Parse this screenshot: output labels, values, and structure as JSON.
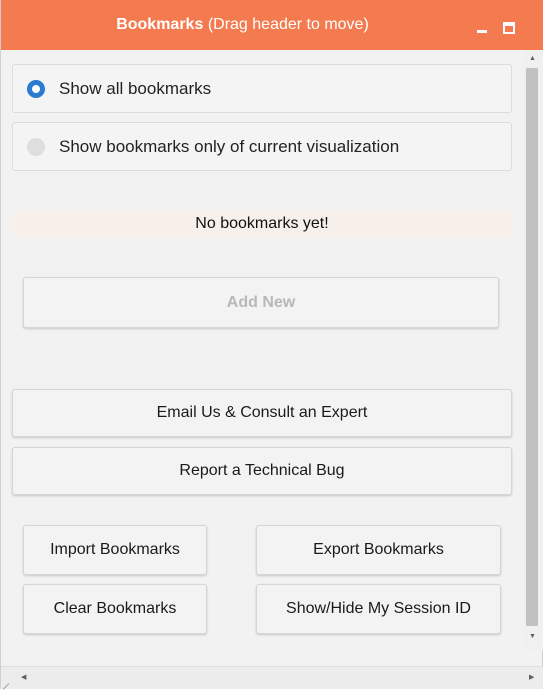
{
  "header": {
    "title": "Bookmarks",
    "subtitle": "(Drag header to move)",
    "accent_color": "#f47b4f",
    "minimize_icon": "minimize-icon",
    "maximize_icon": "maximize-icon"
  },
  "filter": {
    "options": [
      {
        "label": "Show all bookmarks",
        "selected": true
      },
      {
        "label": "Show bookmarks only of current visualization",
        "selected": false
      }
    ]
  },
  "bookmarks": {
    "empty_message": "No bookmarks yet!",
    "add_new_label": "Add New",
    "add_new_enabled": false
  },
  "actions": {
    "email_label": "Email Us & Consult an Expert",
    "report_bug_label": "Report a Technical Bug",
    "import_label": "Import Bookmarks",
    "export_label": "Export Bookmarks",
    "clear_label": "Clear Bookmarks",
    "session_label": "Show/Hide My Session ID"
  },
  "colors": {
    "radio_selected": "#2b7bd1",
    "panel_background": "#f2f2f2"
  }
}
